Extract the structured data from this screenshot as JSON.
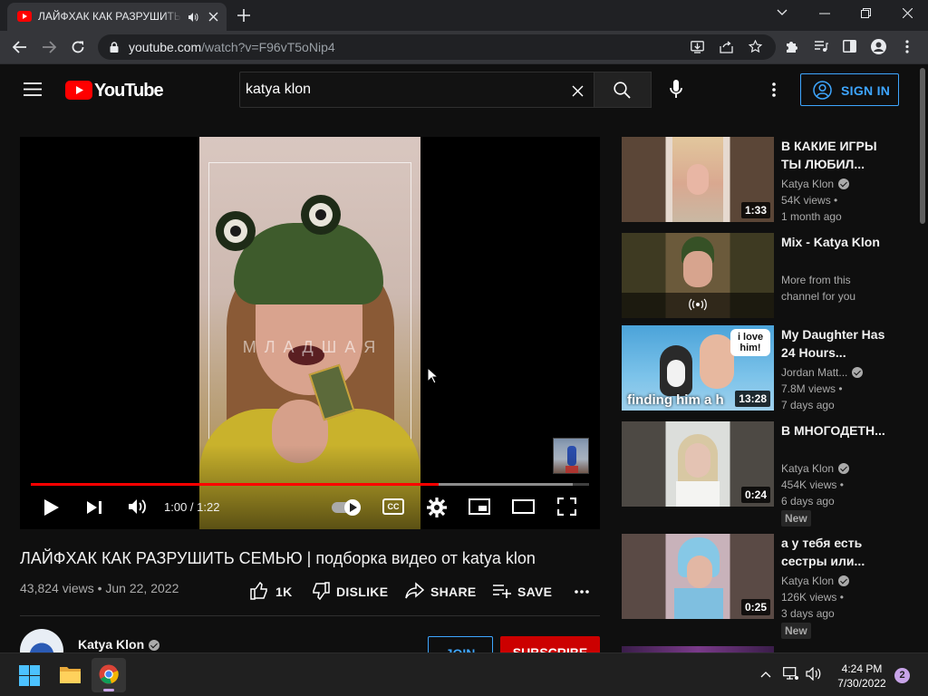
{
  "browser": {
    "tab_title": "ЛАЙФХАК КАК РАЗРУШИТЬ",
    "url_host": "youtube.com",
    "url_rest": "/watch?v=F96vT5oNip4"
  },
  "youtube": {
    "logo_text": "YouTube",
    "search_value": "katya klon",
    "signin_label": "SIGN IN"
  },
  "player": {
    "current_time": "1:00",
    "duration": "1:22",
    "time_text": "1:00 / 1:22",
    "progress_fraction": 0.73,
    "buffered_fraction": 0.97,
    "overlay_text": "М Л А Д Ш А Я",
    "cc_label": "CC"
  },
  "video": {
    "title": "ЛАЙФХАК КАК РАЗРУШИТЬ СЕМЬЮ | подборка видео от katya klon",
    "meta": "43,824 views • Jun 22, 2022",
    "actions": {
      "like": "1K",
      "dislike": "DISLIKE",
      "share": "SHARE",
      "save": "SAVE"
    },
    "channel": {
      "name": "Katya Klon",
      "join_label": "JOIN",
      "subscribe_label": "SUBSCRIBE"
    }
  },
  "recommendations": [
    {
      "title": "В КАКИЕ ИГРЫ ТЫ ЛЮБИЛ...",
      "channel": "Katya Klon",
      "views": "54K views •",
      "age": "1 month ago",
      "duration": "1:33"
    },
    {
      "title": "Mix - Katya Klon",
      "line1": "More from this",
      "line2": "channel for you"
    },
    {
      "title": "My Daughter Has 24 Hours...",
      "channel": "Jordan Matt...",
      "views": "7.8M views •",
      "age": "7 days ago",
      "duration": "13:28",
      "thumb_caption": "finding him a h",
      "thumb_bubble": "i love him!"
    },
    {
      "title": "В МНОГОДЕТН...",
      "channel": "Katya Klon",
      "views": "454K views •",
      "age": "6 days ago",
      "duration": "0:24",
      "badge": "New"
    },
    {
      "title": "а у тебя есть сестры или...",
      "channel": "Katya Klon",
      "views": "126K views •",
      "age": "3 days ago",
      "duration": "0:25",
      "badge": "New"
    }
  ],
  "taskbar": {
    "time": "4:24 PM",
    "date": "7/30/2022",
    "notification_count": "2"
  },
  "colors": {
    "accent_blue": "#3ea6ff",
    "brand_red": "#ff0000",
    "background": "#0f0f0f"
  }
}
